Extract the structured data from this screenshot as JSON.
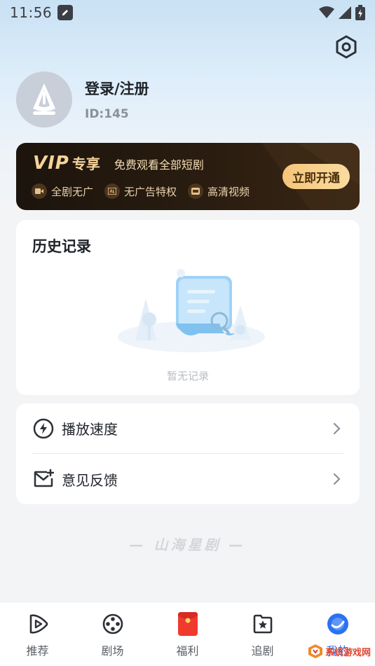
{
  "status_bar": {
    "time": "11:56"
  },
  "profile": {
    "login_label": "登录/注册",
    "user_id": "ID:145"
  },
  "vip": {
    "logo": "VIP",
    "exclusive": "专享",
    "slogan": "免费观看全部短剧",
    "perks": [
      "全剧无广",
      "无广告特权",
      "高清视频"
    ],
    "open_button": "立即开通"
  },
  "history": {
    "title": "历史记录",
    "empty_text": "暂无记录"
  },
  "settings": {
    "items": [
      {
        "label": "播放速度",
        "icon": "lightning-icon"
      },
      {
        "label": "意见反馈",
        "icon": "feedback-mail-icon"
      }
    ]
  },
  "brand_watermark": "— 山海星剧 —",
  "bottom_nav": {
    "items": [
      {
        "label": "推荐",
        "icon": "play-icon"
      },
      {
        "label": "剧场",
        "icon": "film-reel-icon"
      },
      {
        "label": "福利",
        "icon": "red-envelope-icon"
      },
      {
        "label": "追剧",
        "icon": "star-folder-icon"
      },
      {
        "label": "我的",
        "icon": "profile-icon"
      }
    ],
    "active_index": 4
  },
  "site_watermark": "系统游戏网",
  "colors": {
    "accent": "#2a72f3",
    "vip_gold": "#f6d39a",
    "page_bg": "#f3f4f6"
  }
}
